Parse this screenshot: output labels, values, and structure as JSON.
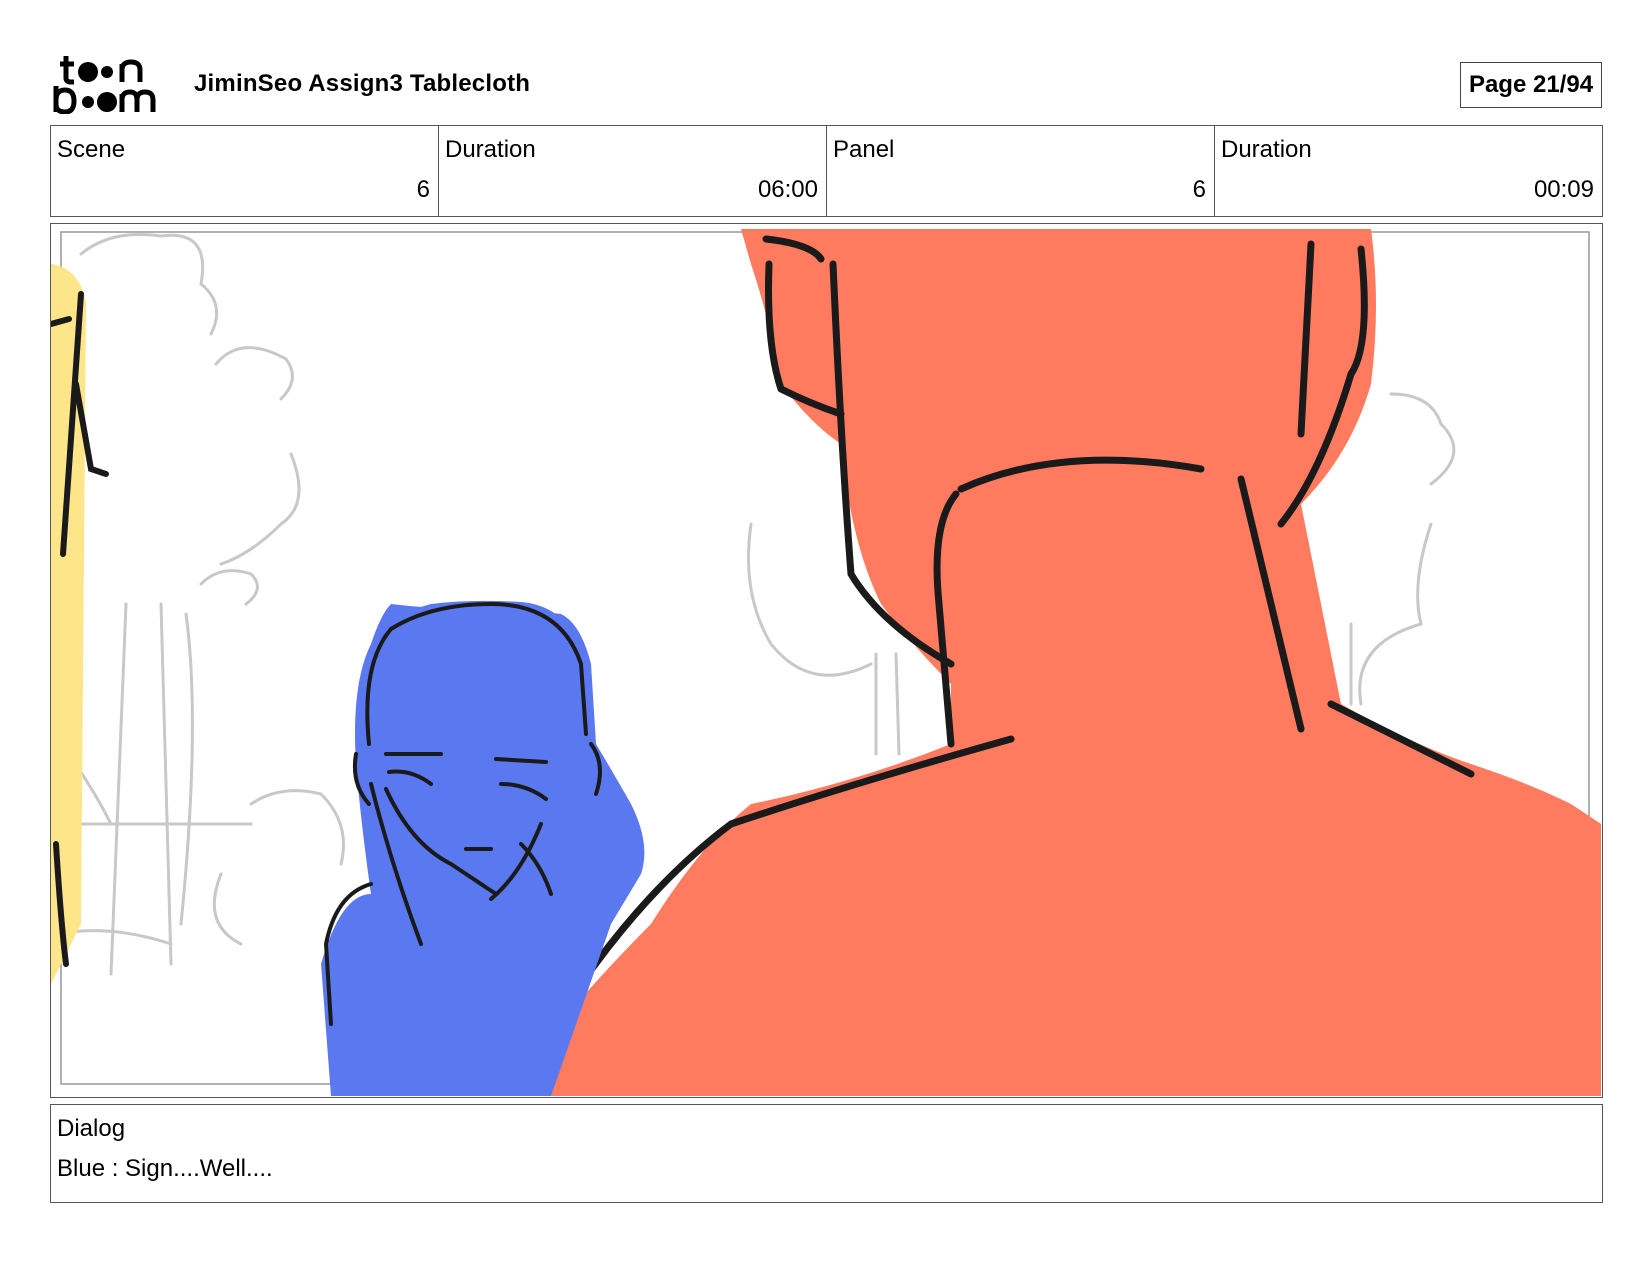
{
  "header": {
    "logo_text_top": "toon",
    "logo_text_bottom": "boom",
    "title": "JiminSeo Assign3 Tablecloth",
    "page": "Page 21/94"
  },
  "info": [
    {
      "label": "Scene",
      "value": "6"
    },
    {
      "label": "Duration",
      "value": "06:00"
    },
    {
      "label": "Panel",
      "value": "6"
    },
    {
      "label": "Duration",
      "value": "00:09"
    }
  ],
  "panel": {
    "colors": {
      "orange_character": "#ff7b60",
      "blue_character": "#5a78f0",
      "yellow_character": "#fde58a",
      "ink": "#1a1a1a",
      "sketch": "#c8c8c8"
    }
  },
  "dialog": {
    "label": "Dialog",
    "text": "Blue : Sign....Well...."
  }
}
